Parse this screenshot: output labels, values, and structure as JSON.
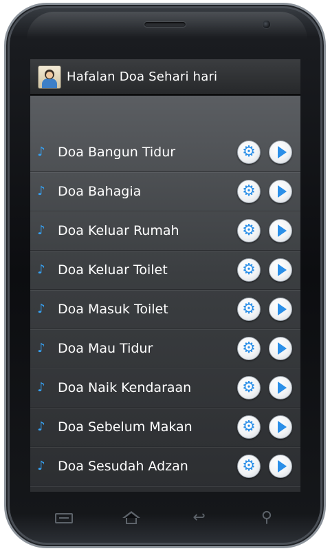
{
  "app": {
    "title": "Hafalan Doa Sehari hari",
    "icon": "app-icon-boy-praying"
  },
  "list": {
    "row_icon": "music-note-icon",
    "row_icon_glyph": "♪",
    "settings_icon": "gear-icon",
    "settings_glyph": "⚙",
    "play_icon": "play-icon",
    "items": [
      {
        "label": "Doa Bangun Tidur"
      },
      {
        "label": "Doa Bahagia"
      },
      {
        "label": "Doa Keluar Rumah"
      },
      {
        "label": "Doa Keluar Toilet"
      },
      {
        "label": "Doa Masuk Toilet"
      },
      {
        "label": "Doa Mau Tidur"
      },
      {
        "label": "Doa Naik Kendaraan"
      },
      {
        "label": "Doa Sebelum Makan"
      },
      {
        "label": "Doa Sesudah Adzan"
      }
    ]
  },
  "nav": {
    "menu_icon": "menu-icon",
    "home_icon": "home-icon",
    "back_icon": "back-icon",
    "back_glyph": "↩",
    "search_icon": "search-icon",
    "search_glyph": "⚲"
  },
  "colors": {
    "accent": "#2b8fe8",
    "note": "#36a2f4",
    "action_bar": "#2e3032",
    "list_background": "#45484c"
  }
}
